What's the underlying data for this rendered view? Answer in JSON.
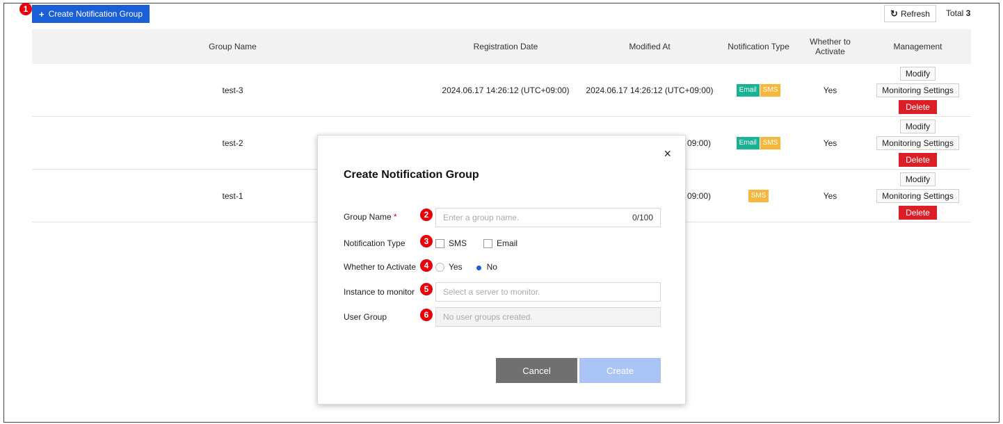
{
  "toolbar": {
    "create_label": "Create Notification Group",
    "refresh_label": "Refresh",
    "total_label": "Total",
    "total_count": "3"
  },
  "markers": [
    "1",
    "2",
    "3",
    "4",
    "5",
    "6"
  ],
  "table": {
    "headers": [
      "Group Name",
      "Registration Date",
      "Modified At",
      "Notification Type",
      "Whether to Activate",
      "Management"
    ],
    "rows": [
      {
        "name": "test-3",
        "registered": "2024.06.17 14:26:12 (UTC+09:00)",
        "modified": "2024.06.17 14:26:12 (UTC+09:00)",
        "types": [
          "Email",
          "SMS"
        ],
        "active": "Yes"
      },
      {
        "name": "test-2",
        "registered": "",
        "modified": "09:00)",
        "types": [
          "Email",
          "SMS"
        ],
        "active": "Yes"
      },
      {
        "name": "test-1",
        "registered": "",
        "modified": "09:00)",
        "types": [
          "SMS"
        ],
        "active": "Yes"
      }
    ],
    "actions": {
      "modify": "Modify",
      "monitoring": "Monitoring Settings",
      "delete": "Delete"
    }
  },
  "modal": {
    "title": "Create Notification Group",
    "close": "×",
    "group_name_label": "Group Name",
    "required_mark": "*",
    "group_name_placeholder": "Enter a group name.",
    "group_name_counter": "0/100",
    "notification_type_label": "Notification Type",
    "sms_label": "SMS",
    "email_label": "Email",
    "activate_label": "Whether to Activate",
    "yes_label": "Yes",
    "no_label": "No",
    "activate_selected": "No",
    "instance_label": "Instance to monitor",
    "instance_placeholder": "Select a server to monitor.",
    "user_group_label": "User Group",
    "user_group_placeholder": "No user groups created.",
    "cancel_label": "Cancel",
    "create_label": "Create"
  },
  "colors": {
    "primary": "#1a5fd6",
    "danger": "#dc1f26",
    "email_badge": "#19b394",
    "sms_badge": "#f6b73c",
    "marker": "#e8000b",
    "create_disabled": "#a9c4f5"
  }
}
